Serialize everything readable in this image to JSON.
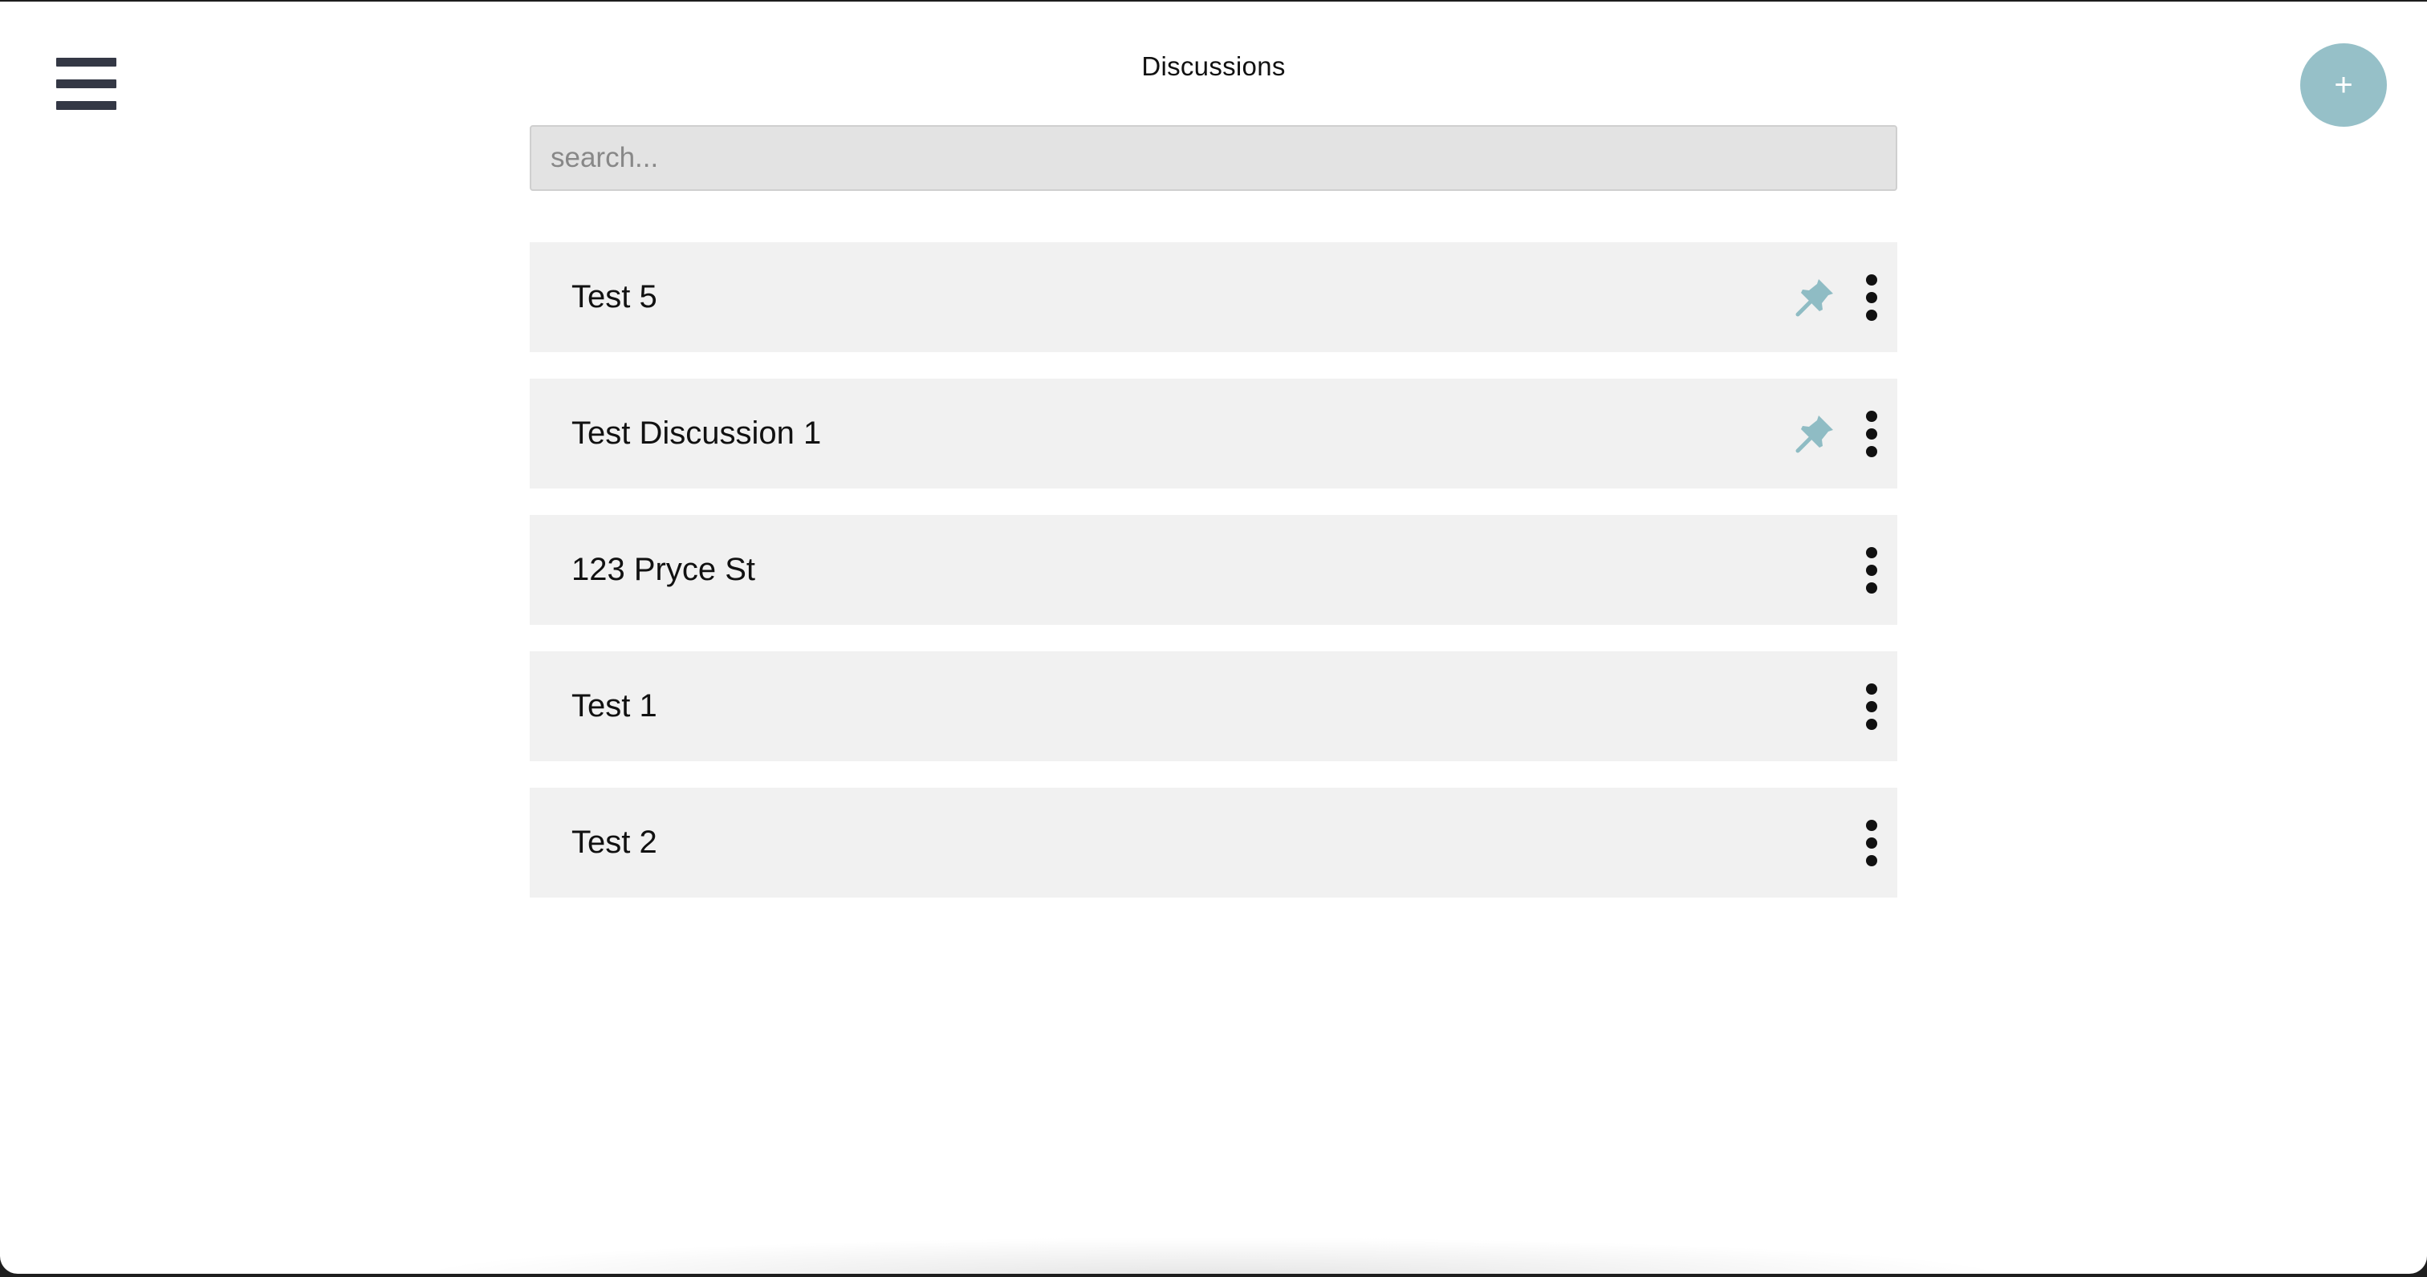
{
  "header": {
    "title": "Discussions",
    "menu_icon": "hamburger-menu-icon",
    "add_label": "+"
  },
  "search": {
    "placeholder": "search...",
    "value": ""
  },
  "discussions": [
    {
      "title": "Test 5",
      "pinned": true
    },
    {
      "title": "Test Discussion 1",
      "pinned": true
    },
    {
      "title": "123 Pryce St",
      "pinned": false
    },
    {
      "title": "Test 1",
      "pinned": false
    },
    {
      "title": "Test 2",
      "pinned": false
    }
  ],
  "colors": {
    "accent": "#96c0c8",
    "pin": "#8fbcc4",
    "item_background": "#f1f1f1",
    "search_background": "#e3e3e3",
    "menu_icon": "#343845"
  }
}
